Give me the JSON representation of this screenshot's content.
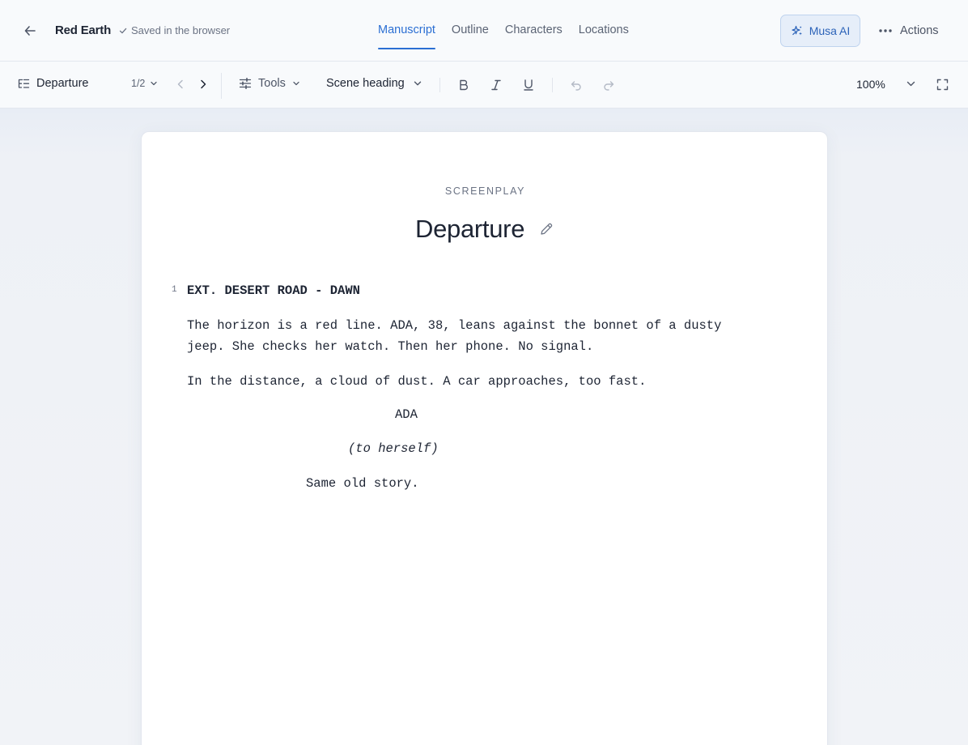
{
  "header": {
    "project_title": "Red Earth",
    "save_status": "Saved in the browser",
    "tabs": [
      {
        "label": "Manuscript",
        "active": true
      },
      {
        "label": "Outline",
        "active": false
      },
      {
        "label": "Characters",
        "active": false
      },
      {
        "label": "Locations",
        "active": false
      }
    ],
    "ai_button": "Musa AI",
    "actions_button": "Actions",
    "icons": {
      "back": "arrow-left-icon",
      "status": "check-icon",
      "ai": "sparkles-icon",
      "actions": "ellipsis-icon"
    }
  },
  "toolbar": {
    "scene_select": "Departure",
    "page_indicator": "1/2",
    "tools_label": "Tools",
    "format_select": "Scene heading",
    "format_buttons": [
      "bold-icon",
      "italic-icon",
      "underline-icon"
    ],
    "history_buttons": [
      "undo-icon",
      "redo-icon"
    ],
    "zoom": "100%"
  },
  "document": {
    "type_label": "SCREENPLAY",
    "title": "Departure",
    "scene_number": "1",
    "scene_heading": "EXT. DESERT ROAD - DAWN",
    "action_1_line_1": "The horizon is a red line. ADA, 38, leans against the bonnet of a dusty",
    "action_1_line_2": "jeep. She checks her watch. Then her phone. No signal.",
    "action_2": "In the distance, a cloud of dust. A car approaches, too fast.",
    "character": "ADA",
    "parenthetical": "(to herself)",
    "dialogue": "Same old story."
  },
  "colors": {
    "accent": "#2b6fd3",
    "ai_button_bg": "#e6eef9",
    "text": "#1d2433",
    "muted": "#6b7384",
    "canvas": "#eef1f6"
  }
}
